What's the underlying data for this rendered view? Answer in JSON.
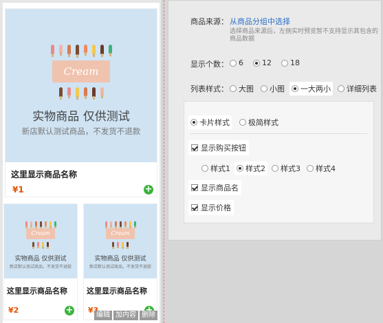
{
  "preview": {
    "large_card": {
      "banner_text": "Cream",
      "img_title": "实物商品 仅供测试",
      "img_subtitle": "新店默认测试商品，不发货不退款",
      "name": "这里显示商品名称",
      "price": "¥1"
    },
    "small_cards": [
      {
        "banner_text": "Cream",
        "img_title": "实物商品 仅供测试",
        "img_subtitle": "新店默认测试商品，不发货不退款",
        "name": "这里显示商品名称",
        "price": "¥2"
      },
      {
        "banner_text": "Cream",
        "img_title": "实物商品 仅供测试",
        "img_subtitle": "新店默认测试商品，不发货不退款",
        "name": "这里显示商品名称",
        "price": "¥3"
      }
    ],
    "add_icon": "+",
    "edit_bar": {
      "edit": "编辑",
      "add_content": "加内容",
      "delete": "删除"
    }
  },
  "settings": {
    "source": {
      "label": "商品来源：",
      "link": "从商品分组中选择",
      "hint_line1": "选择商品来源后，左侧实时预览暂不支持显示其包含的",
      "hint_line2": "商品数据"
    },
    "count": {
      "label": "显示个数：",
      "options": [
        "6",
        "12",
        "18"
      ],
      "selected": "12"
    },
    "list_style": {
      "label": "列表样式：",
      "options": [
        "大图",
        "小图",
        "一大两小",
        "详细列表"
      ],
      "selected": "一大两小"
    },
    "card_style": {
      "options": [
        "卡片样式",
        "极简样式"
      ],
      "selected": "卡片样式"
    },
    "show_buy_button": {
      "label": "显示购买按钮",
      "checked": true
    },
    "buy_button_style": {
      "options": [
        "样式1",
        "样式2",
        "样式3",
        "样式4"
      ],
      "selected": "样式2"
    },
    "show_name": {
      "label": "显示商品名",
      "checked": true
    },
    "show_price": {
      "label": "显示价格",
      "checked": true
    }
  },
  "colors": {
    "accent_link": "#2a6fc9",
    "price": "#e35400",
    "add_button": "#3db33d",
    "image_bg": "#cfe3f3"
  }
}
